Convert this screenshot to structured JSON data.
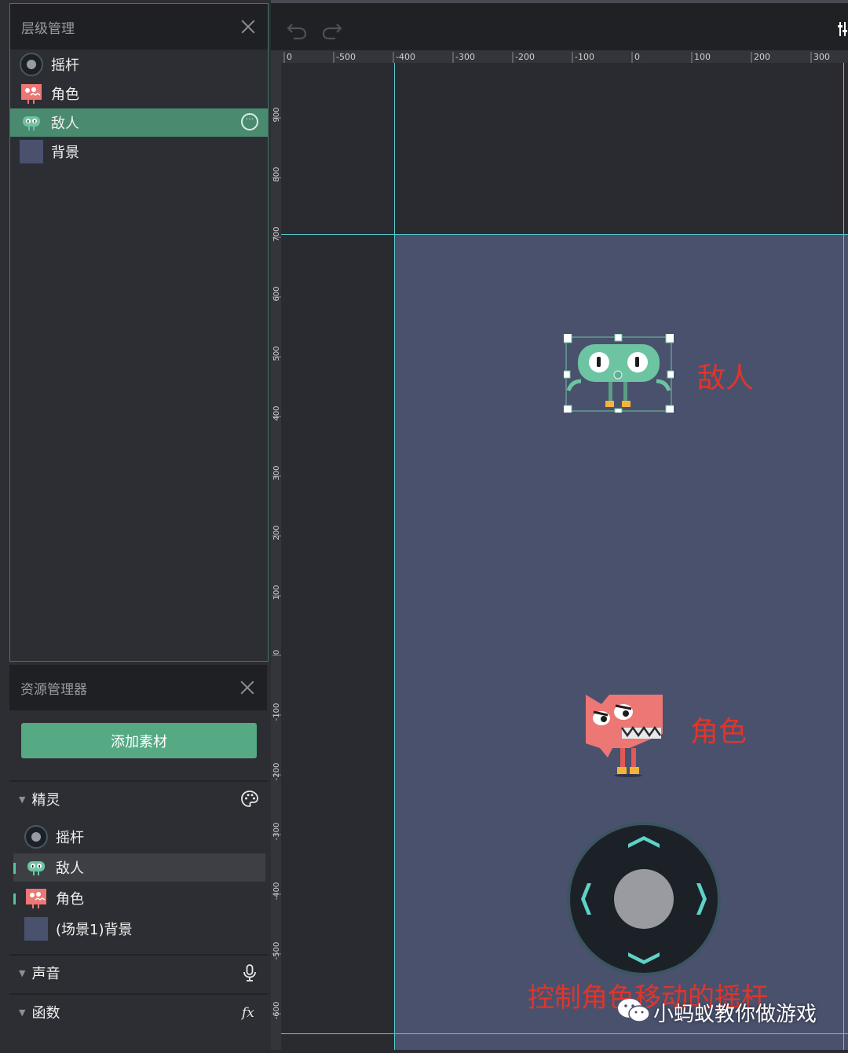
{
  "layer_panel": {
    "title": "层级管理",
    "items": [
      {
        "label": "摇杆",
        "icon": "joystick-icon"
      },
      {
        "label": "角色",
        "icon": "red-monster-icon"
      },
      {
        "label": "敌人",
        "icon": "green-monster-icon",
        "selected": true
      },
      {
        "label": "背景",
        "icon": "background-swatch-icon"
      }
    ]
  },
  "asset_panel": {
    "title": "资源管理器",
    "add_button": "添加素材",
    "sections": {
      "sprites": {
        "label": "精灵",
        "icon": "palette-icon",
        "items": [
          {
            "label": "摇杆"
          },
          {
            "label": "敌人"
          },
          {
            "label": "角色"
          },
          {
            "label": "(场景1)背景"
          }
        ]
      },
      "sound": {
        "label": "声音",
        "icon": "microphone-icon"
      },
      "functions": {
        "label": "函数",
        "icon": "fx-icon"
      }
    }
  },
  "ruler": {
    "horizontal": [
      "0",
      "-500",
      "-400",
      "-300",
      "-200",
      "-100",
      "0",
      "100",
      "200",
      "300"
    ],
    "vertical": [
      "900",
      "800",
      "700",
      "600",
      "500",
      "400",
      "300",
      "200",
      "100",
      "0",
      "-100",
      "-200",
      "-300",
      "-400",
      "-500",
      "-600"
    ]
  },
  "canvas": {
    "annotations": {
      "enemy": "敌人",
      "character": "角色",
      "joystick": "控制角色移动的摇杆"
    },
    "watermark": "小蚂蚁教你做游戏"
  },
  "colors": {
    "accent": "#55aa84",
    "selected_row": "#4a8a6e",
    "stage": "#4a516d",
    "guide": "#58c9cf",
    "annotation": "#e0352b",
    "enemy_body": "#6cc4a2",
    "character_body": "#ec7774"
  }
}
